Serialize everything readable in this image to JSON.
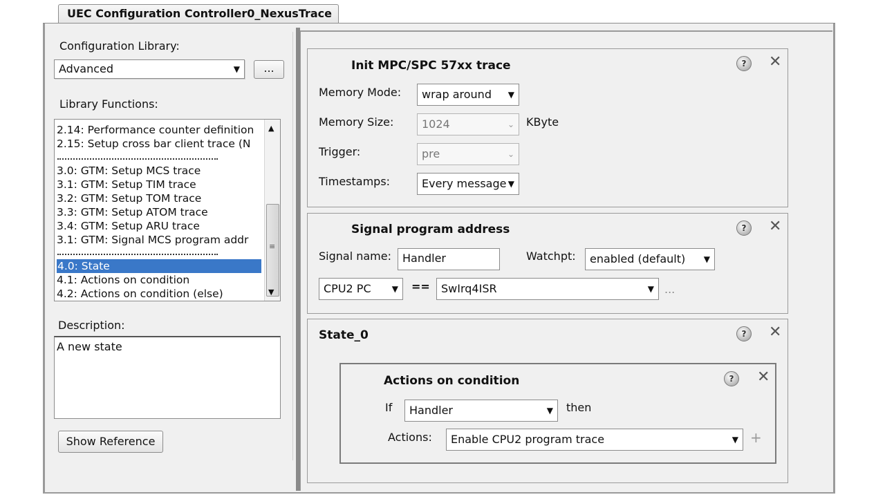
{
  "tab": {
    "title": "UEC Configuration Controller0_NexusTrace"
  },
  "left": {
    "config_library_label": "Configuration Library:",
    "config_library_value": "Advanced",
    "browse_label": "...",
    "library_functions_label": "Library Functions:",
    "functions": [
      "2.14: Performance counter definition",
      "2.15: Setup cross bar client trace (N",
      "3.0: GTM: Setup MCS trace",
      "3.1: GTM: Setup TIM trace",
      "3.2: GTM: Setup TOM trace",
      "3.3: GTM: Setup ATOM trace",
      "3.4: GTM: Setup ARU trace",
      "3.1:  GTM:  Signal MCS  program addr",
      "4.0: State",
      "4.1: Actions on condition",
      "4.2: Actions on condition (else)"
    ],
    "selected_function": "4.0: State",
    "description_label": "Description:",
    "description_text": "A new state",
    "show_reference_label": "Show Reference"
  },
  "init_trace": {
    "title": "Init MPC/SPC 57xx trace",
    "memory_mode_label": "Memory Mode:",
    "memory_mode_value": "wrap around",
    "memory_size_label": "Memory Size:",
    "memory_size_value": "1024",
    "memory_size_unit": "KByte",
    "trigger_label": "Trigger:",
    "trigger_value": "pre",
    "timestamps_label": "Timestamps:",
    "timestamps_value": "Every message"
  },
  "signal": {
    "title": "Signal program address",
    "signal_name_label": "Signal name:",
    "signal_name_value": "Handler",
    "watchpt_label": "Watchpt:",
    "watchpt_value": "enabled (default)",
    "source_value": "CPU2 PC",
    "operator": "==",
    "target_value": "SwIrq4ISR",
    "more_label": "..."
  },
  "state": {
    "title": "State_0",
    "actions": {
      "title": "Actions on condition",
      "if_label": "If",
      "if_value": "Handler",
      "then_label": "then",
      "actions_label": "Actions:",
      "actions_value": "Enable CPU2 program trace",
      "add_label": "+"
    }
  },
  "icons": {
    "help": "help-icon",
    "close": "close-icon",
    "dropdown": "chevron-down-icon"
  }
}
